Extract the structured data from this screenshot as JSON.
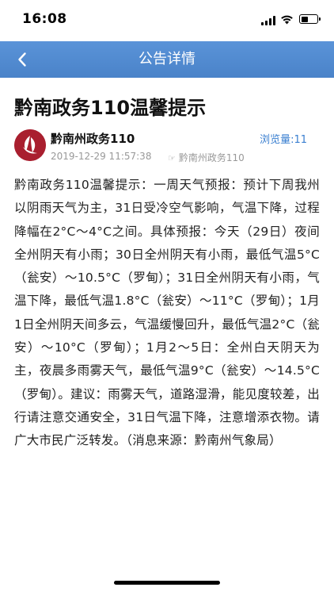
{
  "status_bar": {
    "time": "16:08",
    "icons": [
      "signal-icon",
      "wifi-icon",
      "battery-icon"
    ]
  },
  "nav": {
    "title": "公告详情",
    "back_icon": "chevron-left-icon",
    "background_color": "#4f88cf"
  },
  "article": {
    "title": "黔南政务110温馨提示",
    "author": "黔南州政务110",
    "views_label": "浏览量:",
    "views_count": "11",
    "timestamp": "2019-12-29 11:57:38",
    "source_icon": "hand-pointer-icon",
    "source": "黔南州政务110",
    "body": "黔南政务110温馨提示：一周天气预报：预计下周我州以阴雨天气为主，31日受冷空气影响，气温下降，过程降幅在2°C～4°C之间。具体预报：今天（29日）夜间全州阴天有小雨；30日全州阴天有小雨，最低气温5°C（瓮安）～10.5°C（罗甸）；31日全州阴天有小雨，气温下降，最低气温1.8°C（瓮安）～11°C（罗甸）；1月1日全州阴天间多云，气温缓慢回升，最低气温2°C（瓮安）～10°C（罗甸）；1月2～5日：全州白天阴天为主，夜晨多雨雾天气，最低气温9°C（瓮安）～14.5°C（罗甸）。建议：雨雾天气，道路湿滑，能见度较差，出行请注意交通安全，31日气温下降，注意增添衣物。请广大市民广泛转发。（消息来源：黔南州气象局）"
  },
  "colors": {
    "accent": "#3a7fd0",
    "avatar_bg": "#a91f2f"
  }
}
